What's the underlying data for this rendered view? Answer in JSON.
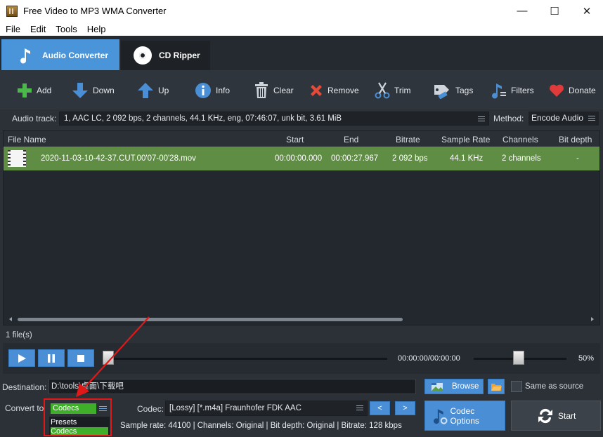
{
  "window": {
    "title": "Free Video to MP3 WMA Converter",
    "minimize": "—",
    "maximize": "☐",
    "close": "✕"
  },
  "menu": [
    "File",
    "Edit",
    "Tools",
    "Help"
  ],
  "tabs": [
    {
      "label": "Audio Converter",
      "icon": "music-note-icon",
      "active": true
    },
    {
      "label": "CD Ripper",
      "icon": "cd-disc-icon",
      "active": false
    }
  ],
  "toolbar": {
    "add": "Add",
    "down": "Down",
    "up": "Up",
    "info": "Info",
    "clear": "Clear",
    "remove": "Remove",
    "trim": "Trim",
    "tags": "Tags",
    "filters": "Filters",
    "donate": "Donate"
  },
  "audio_track": {
    "label": "Audio track:",
    "value": "1, AAC LC, 2 092 bps, 2 channels, 44.1 KHz, eng, 07:46:07, unk bit, 3.61 MiB",
    "method_label": "Method:",
    "method_value": "Encode Audio"
  },
  "file_list": {
    "columns": [
      "File Name",
      "Start",
      "End",
      "Bitrate",
      "Sample Rate",
      "Channels",
      "Bit depth"
    ],
    "rows": [
      {
        "name": "2020-11-03-10-42-37.CUT.00'07-00'28.mov",
        "start": "00:00:00.000",
        "end": "00:00:27.967",
        "bitrate": "2 092 bps",
        "sample_rate": "44.1 KHz",
        "channels": "2 channels",
        "bit_depth": "-"
      }
    ]
  },
  "file_count": "1 file(s)",
  "player": {
    "time": "00:00:00/00:00:00",
    "volume": "50%",
    "seek_position": 0,
    "volume_level": 0.5
  },
  "destination": {
    "label": "Destination:",
    "value": "D:\\tools\\桌面\\下载吧",
    "browse": "Browse",
    "same_as_source": "Same as source"
  },
  "convert": {
    "label": "Convert to",
    "selected": "Codecs",
    "options": [
      "Presets",
      "Codecs"
    ],
    "codec_label": "Codec:",
    "codec_value": "[Lossy] [*.m4a] Fraunhofer FDK AAC",
    "prev": "<",
    "next": ">",
    "sample_info": "Sample rate: 44100 | Channels: Original | Bit depth: Original | Bitrate: 128 kbps",
    "codec_options": "Codec Options",
    "start": "Start"
  },
  "colors": {
    "accent": "#4a95d9",
    "selected_row": "#5e8d43",
    "highlight_green": "#3fae29",
    "annotation_red": "#e01818"
  }
}
